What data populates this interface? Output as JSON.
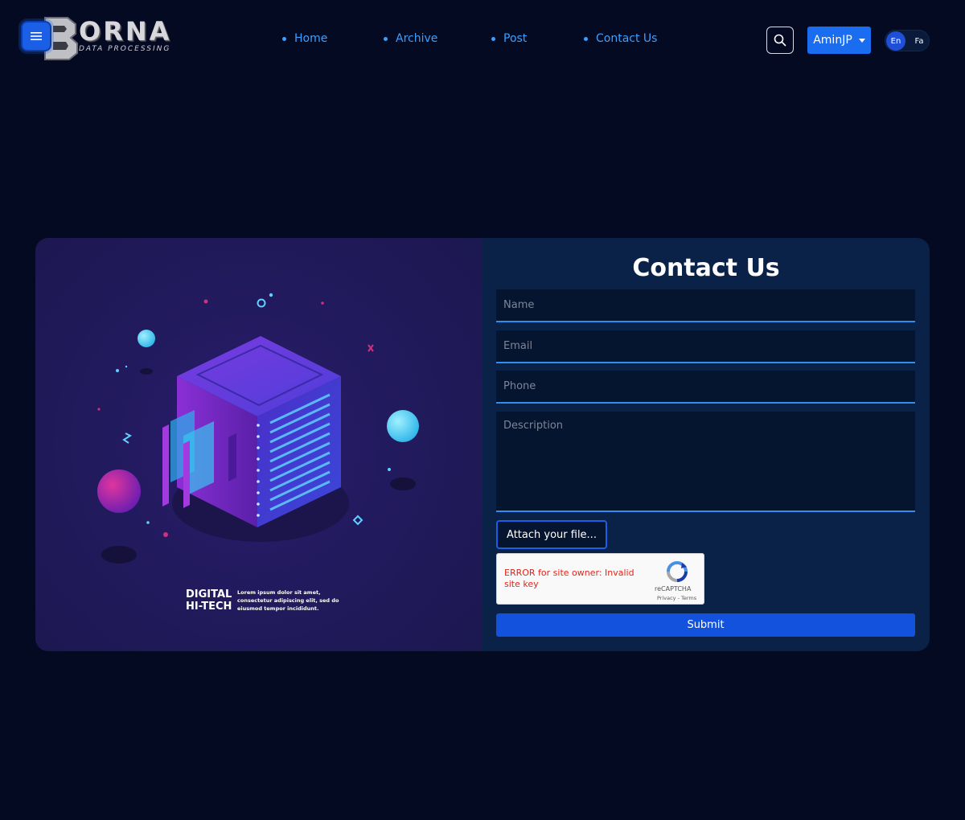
{
  "brand": {
    "name": "ORNA",
    "letter_mark": "B",
    "tagline": "DATA PROCESSING"
  },
  "nav": {
    "items": [
      {
        "label": "Home"
      },
      {
        "label": "Archive"
      },
      {
        "label": "Post"
      },
      {
        "label": "Contact Us"
      }
    ],
    "accent": "#3aa0ff"
  },
  "header": {
    "user_label": "AminJP",
    "lang_en": "En",
    "lang_fa": "Fa"
  },
  "artwork": {
    "title": "DIGITAL HI-TECH",
    "title_line1": "DIGITAL",
    "title_line2": "HI-TECH",
    "caption": "Lorem ipsum dolor sit amet, consectetur adipiscing elit, sed do eiusmod tempor incididunt."
  },
  "form": {
    "title": "Contact Us",
    "name_placeholder": "Name",
    "email_placeholder": "Email",
    "phone_placeholder": "Phone",
    "description_placeholder": "Description",
    "attach_label": "Attach your file...",
    "submit_label": "Submit"
  },
  "recaptcha": {
    "error": "ERROR for site owner: Invalid site key",
    "name": "reCAPTCHA",
    "terms": "Privacy - Terms"
  },
  "colors": {
    "background": "#050a23",
    "primary_button": "#1a6cf0",
    "form_panel": "#0a2248",
    "field_border": "#2f8ff0"
  }
}
